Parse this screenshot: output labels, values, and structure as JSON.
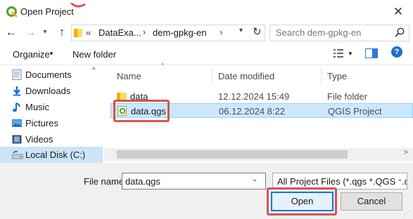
{
  "window": {
    "title": "Open Project",
    "close_icon": "✕"
  },
  "nav": {
    "back_icon": "←",
    "forward_icon": "→",
    "history_icon": "▾",
    "up_icon": "↑",
    "address": {
      "overflow": "«",
      "crumbs": [
        "DataExa...",
        "dem-gpkg-en"
      ],
      "separator": "›",
      "dropdown_icon": "▾",
      "refresh_icon": "↻"
    },
    "search_placeholder": "Search dem-gpkg-en"
  },
  "toolbar": {
    "organize_label": "Organize",
    "organize_caret": "▼",
    "new_folder_label": "New folder",
    "view_caret": "▼",
    "help_label": "?"
  },
  "sidebar": {
    "scroll_up": "^",
    "items": [
      {
        "label": "Documents",
        "icon": "documents-icon"
      },
      {
        "label": "Downloads",
        "icon": "downloads-icon"
      },
      {
        "label": "Music",
        "icon": "music-icon"
      },
      {
        "label": "Pictures",
        "icon": "pictures-icon"
      },
      {
        "label": "Videos",
        "icon": "videos-icon"
      },
      {
        "label": "Local Disk (C:)",
        "icon": "local-disk-icon",
        "selected": true
      }
    ]
  },
  "file_list": {
    "sort_caret": "^",
    "columns": [
      "Name",
      "Date modified",
      "Type"
    ],
    "rows": [
      {
        "name": "data",
        "date": "12.12.2024 15:49",
        "type": "File folder",
        "icon": "folder-icon"
      },
      {
        "name": "data.qgs",
        "date": "06.12.2024 8:22",
        "type": "QGIS Project",
        "icon": "qgis-project-icon",
        "selected": true
      }
    ],
    "scroll_left": "<",
    "scroll_right": ">"
  },
  "footer": {
    "filename_label": "File name:",
    "filename_value": "data.qgs",
    "filename_caret": "⌄",
    "filetype_value": "All Project Files (*.qgs *.QGS *.q",
    "filetype_caret": "⌄",
    "open_label": "Open",
    "cancel_label": "Cancel",
    "resize_grip": "⋰"
  },
  "colors": {
    "accent": "#0078d7",
    "highlight_annotation": "#d9534f",
    "selection": "#cce8ff"
  }
}
